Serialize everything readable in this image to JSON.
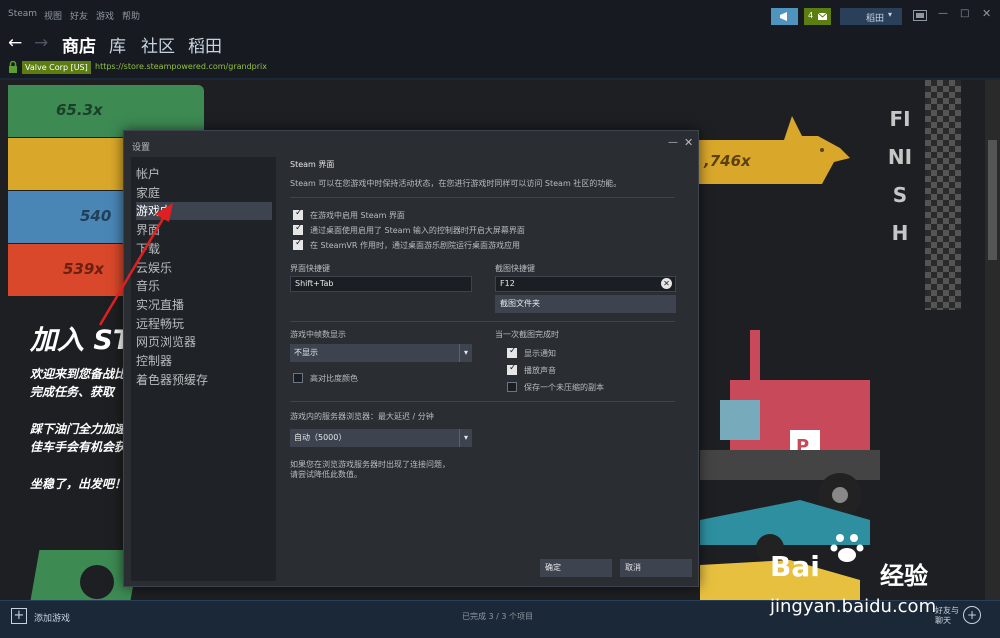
{
  "menu": {
    "items": [
      "Steam",
      "视图",
      "好友",
      "游戏",
      "帮助"
    ]
  },
  "header": {
    "notify_count": "4",
    "username": "稻田",
    "tabs": [
      {
        "label": "商店",
        "active": true
      },
      {
        "label": "库"
      },
      {
        "label": "社区"
      },
      {
        "label": "稻田"
      }
    ]
  },
  "urlbar": {
    "cert": "Valve Corp [US]",
    "url": "https://store.steampowered.com/grandprix"
  },
  "page": {
    "bars": [
      "65.3x",
      "540",
      "539x"
    ],
    "right_bar": ",746x",
    "headline": "加入 ST",
    "paragraphs": [
      "欢迎来到您备战比",
      "完成任务、获取",
      "踩下油门全力加速",
      "佳车手会有机会获",
      "坐稳了，出发吧！"
    ],
    "finish": "FINISH"
  },
  "dialog": {
    "title": "设置",
    "sidebar": [
      "帐户",
      "家庭",
      "游戏中",
      "界面",
      "下载",
      "云娱乐",
      "音乐",
      "实况直播",
      "远程畅玩",
      "网页浏览器",
      "控制器",
      "着色器预缓存"
    ],
    "active_index": 2,
    "section_title": "Steam 界面",
    "section_desc": "Steam 可以在您游戏中时保持活动状态，在您进行游戏时同样可以访问 Steam 社区的功能。",
    "checks": [
      {
        "label": "在游戏中启用 Steam 界面",
        "checked": true
      },
      {
        "label": "通过桌面使用启用了 Steam 输入的控制器时开启大屏幕界面",
        "checked": true
      },
      {
        "label": "在 SteamVR 作用时，通过桌面游乐剧院运行桌面游戏应用",
        "checked": true
      }
    ],
    "overlay_hotkey_label": "界面快捷键",
    "overlay_hotkey": "Shift+Tab",
    "screenshot_hotkey_label": "截图快捷键",
    "screenshot_hotkey": "F12",
    "screenshot_folder_btn": "截图文件夹",
    "fps_label": "游戏中帧数显示",
    "fps_value": "不显示",
    "high_contrast": "高对比度颜色",
    "screenshot_done_label": "当一次截图完成时",
    "screenshot_opts": [
      {
        "label": "显示通知",
        "checked": true
      },
      {
        "label": "播放声音",
        "checked": true
      },
      {
        "label": "保存一个未压缩的副本",
        "checked": false
      }
    ],
    "server_label": "游戏内的服务器浏览器：最大延迟 / 分钟",
    "server_value": "自动（5000）",
    "server_note1": "如果您在浏览游戏服务器时出现了连接问题，",
    "server_note2": "请尝试降低此数值。",
    "ok": "确定",
    "cancel": "取消"
  },
  "bottom": {
    "add_game": "添加游戏",
    "status": "已完成 3 / 3 个项目",
    "friends1": "好友与",
    "friends2": "聊天"
  },
  "watermark": {
    "text": "jingyan.baidu.com",
    "brand": "Bai",
    "brand2": "经验"
  },
  "colors": {
    "green": "#3d8a53",
    "gold": "#d9a72a",
    "blue": "#4a86b5",
    "red": "#d9482a"
  }
}
